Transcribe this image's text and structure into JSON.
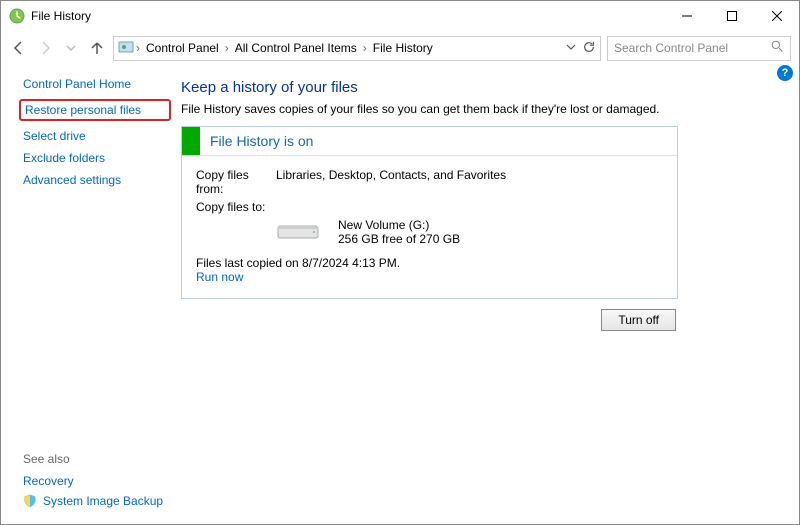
{
  "window": {
    "title": "File History"
  },
  "breadcrumbs": {
    "items": [
      "Control Panel",
      "All Control Panel Items",
      "File History"
    ]
  },
  "search": {
    "placeholder": "Search Control Panel"
  },
  "sidebar": {
    "home": "Control Panel Home",
    "restore": "Restore personal files",
    "select_drive": "Select drive",
    "exclude": "Exclude folders",
    "advanced": "Advanced settings",
    "see_also_label": "See also",
    "recovery": "Recovery",
    "system_image": "System Image Backup"
  },
  "main": {
    "heading": "Keep a history of your files",
    "description": "File History saves copies of your files so you can get them back if they're lost or damaged.",
    "panel_title": "File History is on",
    "copy_from_label": "Copy files from:",
    "copy_from_value": "Libraries, Desktop, Contacts, and Favorites",
    "copy_to_label": "Copy files to:",
    "drive_name": "New Volume (G:)",
    "drive_space": "256 GB free of 270 GB",
    "last_copied": "Files last copied on 8/7/2024 4:13 PM.",
    "run_now": "Run now",
    "turn_off": "Turn off"
  }
}
